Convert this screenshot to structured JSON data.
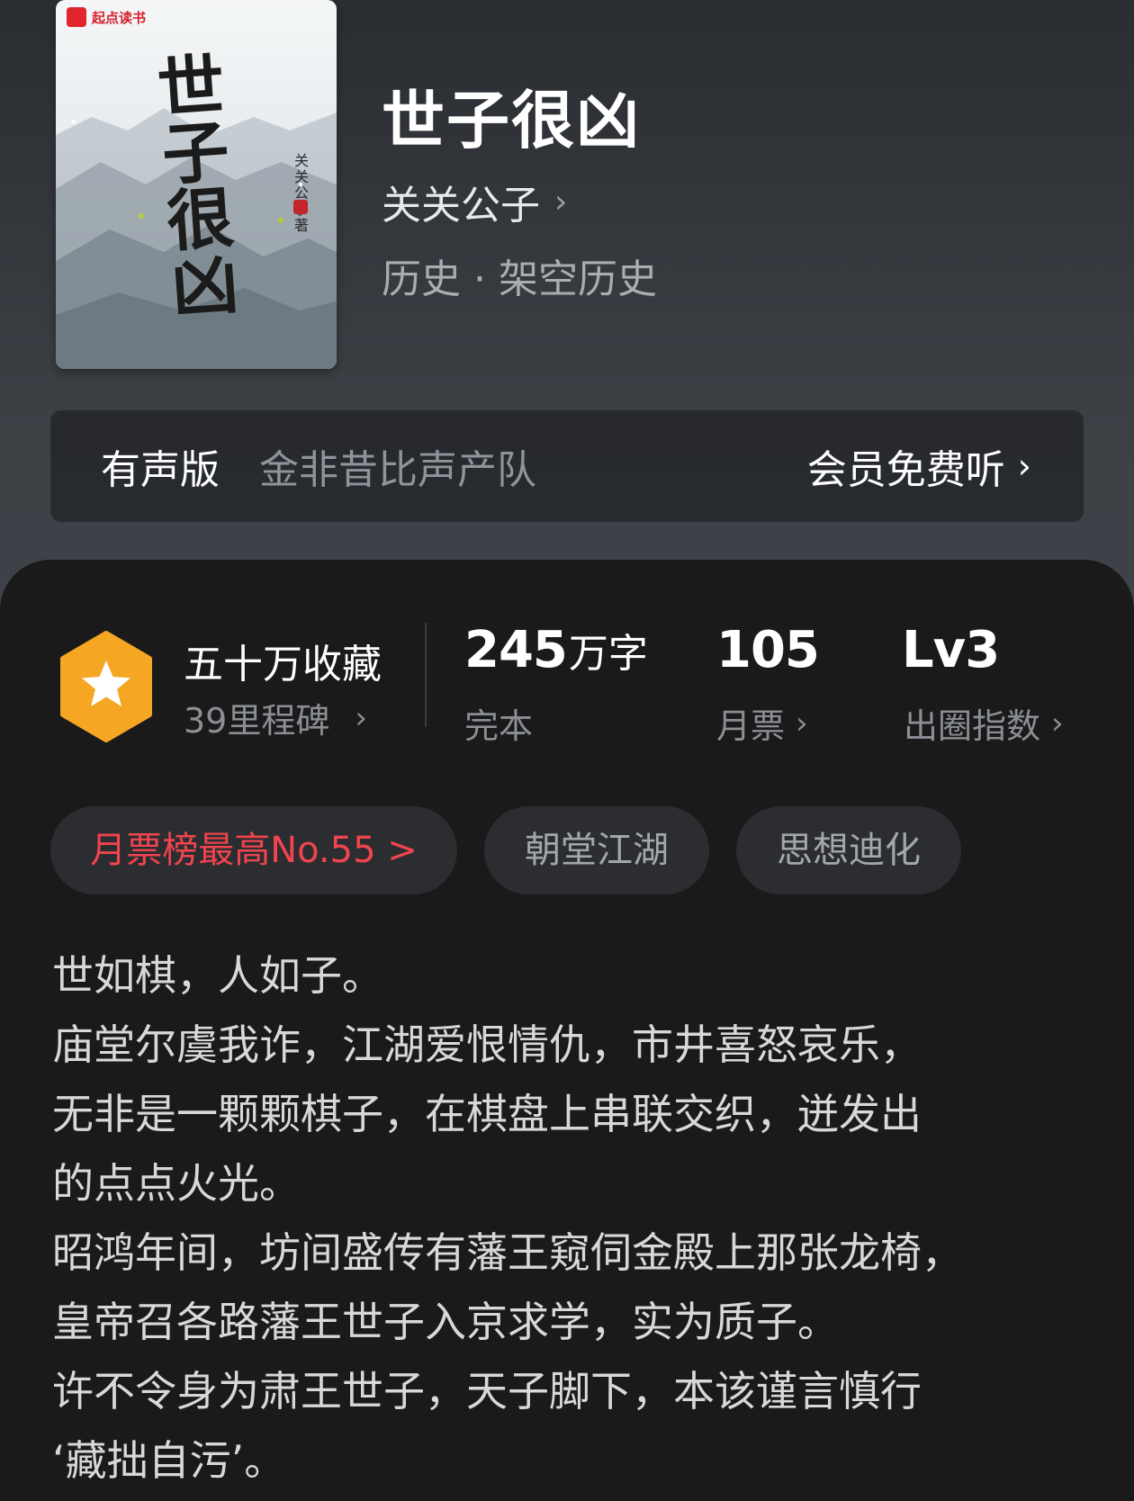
{
  "cover": {
    "brand": "起点读书",
    "title_chars": [
      "世",
      "子",
      "很",
      "凶"
    ],
    "author_vertical": "关关公子著"
  },
  "book": {
    "title": "世子很凶",
    "author": "关关公子",
    "category": "历史 · 架空历史"
  },
  "audio": {
    "label": "有声版",
    "team": "金非昔比声产队",
    "action": "会员免费听"
  },
  "milestone": {
    "title": "五十万收藏",
    "subtitle": "39里程碑"
  },
  "stats": {
    "words_value": "245",
    "words_unit": "万字",
    "words_label": "完本",
    "tickets_value": "105",
    "tickets_label": "月票",
    "level_value": "Lv3",
    "level_label": "出圈指数"
  },
  "tags": [
    {
      "label": "月票榜最高No.55 >"
    },
    {
      "label": "朝堂江湖"
    },
    {
      "label": "思想迪化"
    }
  ],
  "intro_lines": [
    "世如棋，人如子。",
    "庙堂尔虞我诈，江湖爱恨情仇，市井喜怒哀乐，",
    "无非是一颗颗棋子，在棋盘上串联交织，迸发出",
    "的点点火光。",
    "昭鸿年间，坊间盛传有藩王窥伺金殿上那张龙椅，",
    "皇帝召各路藩王世子入京求学，实为质子。",
    "许不令身为肃王世子，天子脚下，本该谨言慎行",
    "‘藏拙自污’。"
  ],
  "colors": {
    "accent_red": "#f0444f",
    "badge_orange": "#f5a623"
  }
}
